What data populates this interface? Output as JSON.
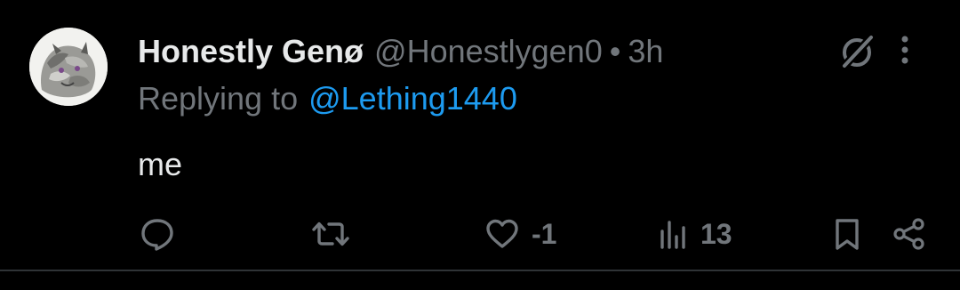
{
  "tweet": {
    "author_name": "Honestly Genø",
    "handle": "@Honestlygen0",
    "separator": "•",
    "time": "3h",
    "replying_label": "Replying to",
    "replying_to": "@Lething1440",
    "text": "me"
  },
  "actions": {
    "reply_count": "",
    "retweet_count": "",
    "like_count": "-1",
    "views_count": "13"
  },
  "colors": {
    "background": "#000000",
    "primary_text": "#e7e9ea",
    "secondary_text": "#71767b",
    "link": "#1d9bf0",
    "divider": "#2f3336"
  },
  "icons": [
    "avatar",
    "grok-icon",
    "more-icon",
    "reply-icon",
    "retweet-icon",
    "like-icon",
    "views-icon",
    "bookmark-icon",
    "share-icon"
  ]
}
